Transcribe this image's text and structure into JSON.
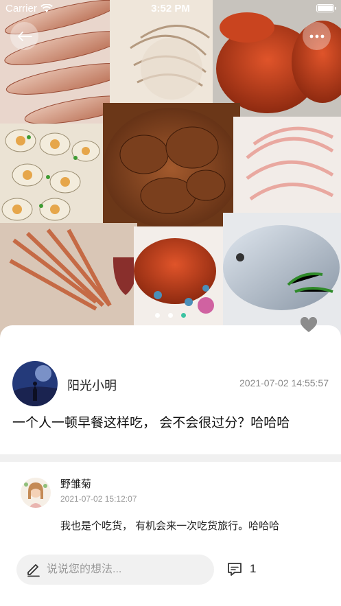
{
  "status_bar": {
    "carrier": "Carrier",
    "time": "3:52 PM"
  },
  "gallery": {
    "image_count": 3,
    "active_index": 2,
    "accent_color": "#3cc3a2"
  },
  "post": {
    "author": "阳光小明",
    "time": "2021-07-02 14:55:57",
    "text": "一个人一顿早餐这样吃， 会不会很过分？哈哈哈"
  },
  "comments": [
    {
      "name": "野雏菊",
      "time": "2021-07-02 15:12:07",
      "text": "我也是个吃货， 有机会来一次吃货旅行。哈哈哈"
    }
  ],
  "composer": {
    "placeholder": "说说您的想法...",
    "comment_count": "1"
  },
  "icons": [
    "back-arrow-icon",
    "more-icon",
    "heart-icon",
    "pencil-icon",
    "comment-icon",
    "wifi-icon",
    "battery-icon"
  ]
}
